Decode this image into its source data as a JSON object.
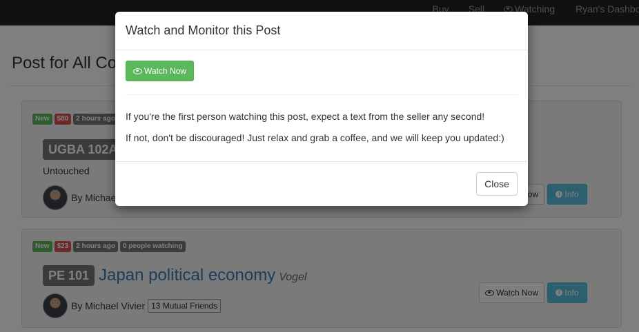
{
  "navbar": {
    "links": {
      "buy": "Buy",
      "sell": "Sell",
      "watching": "Watching",
      "dashboard": "Ryan's Dashboard"
    }
  },
  "page": {
    "title": "Post for All Courses"
  },
  "posts": [
    {
      "badges": {
        "new": "New",
        "price": "$80",
        "age": "2 hours ago"
      },
      "course_code": "UGBA 102A",
      "condition": "Untouched",
      "seller": "By Michael",
      "actions": {
        "watch": "Watch Now",
        "info": "Info"
      }
    },
    {
      "badges": {
        "new": "New",
        "price": "$23",
        "age": "2 hours ago",
        "watching": "0 people watching"
      },
      "course_code": "PE 101",
      "course_name": "Japan political economy",
      "professor": "Vogel",
      "seller": "By Michael Vivier",
      "mutual_friends": "13 Mutual Friends",
      "actions": {
        "watch": "Watch Now",
        "info": "Info"
      }
    }
  ],
  "modal": {
    "title": "Watch and Monitor this Post",
    "watch_button": "Watch Now",
    "text_line1": "If you're the first person watching this post, expect a text from the seller any second!",
    "text_line2": "If not, don't be discouraged! Just relax and grab a coffee, and we will keep you updated:)",
    "close_button": "Close"
  },
  "icons": {
    "eye": "eye-icon",
    "info": "info-circle-icon"
  },
  "colors": {
    "success": "#5cb85c",
    "danger": "#d9534f",
    "info": "#5bc0de",
    "link": "#337ab7",
    "navbar": "#222222"
  }
}
